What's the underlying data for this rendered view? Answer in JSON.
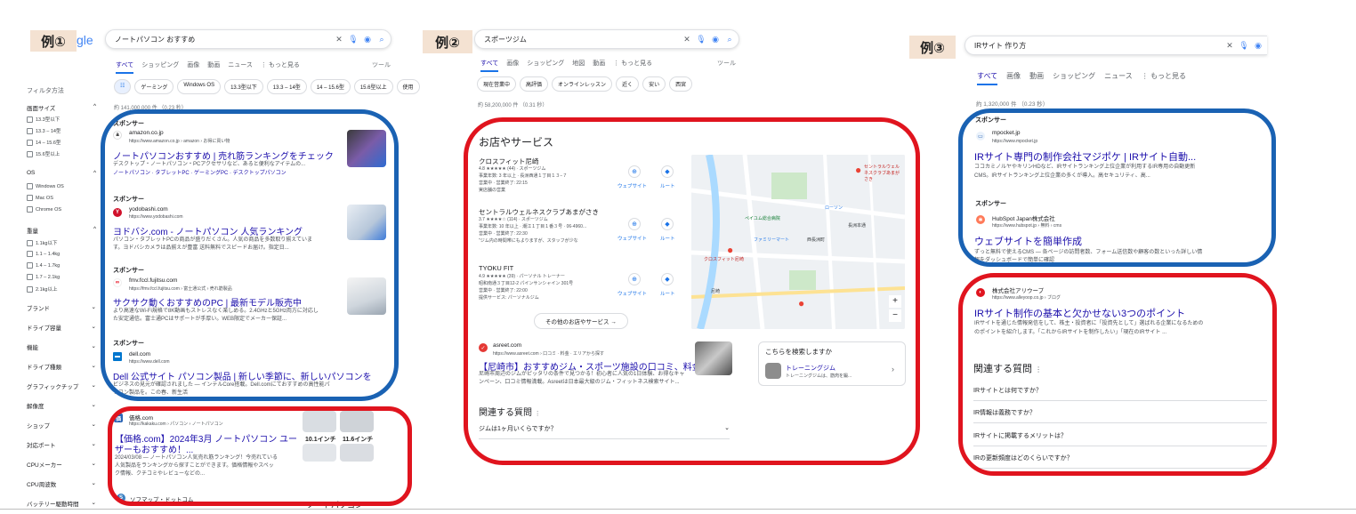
{
  "panel1": {
    "tag": "例①",
    "logo_tail": "gle",
    "query": "ノートパソコン おすすめ",
    "tabs": [
      "すべて",
      "ショッピング",
      "画像",
      "動画",
      "ニュース",
      "⋮ もっと見る"
    ],
    "tools": "ツール",
    "chips": [
      "ゲーミング",
      "Windows OS",
      "13.3型以下",
      "13.3 – 14型",
      "14 – 15.6型",
      "15.6型以上",
      "使用"
    ],
    "result_count": "約 141,000,000 件 （0.23 秒）",
    "filters_title": "フィルタ方法",
    "filter_screen": "画面サイズ",
    "screen_opts": [
      "13.3型以下",
      "13.3 – 14型",
      "14 – 15.6型",
      "15.6型以上"
    ],
    "filter_os": "OS",
    "os_opts": [
      "Windows OS",
      "Mac OS",
      "Chrome OS"
    ],
    "filter_weight": "重量",
    "weight_opts": [
      "1.1kg以下",
      "1.1 – 1.4kg",
      "1.4 – 1.7kg",
      "1.7 – 2.1kg",
      "2.1kg以上"
    ],
    "more_filters": [
      "ブランド",
      "ドライブ容量",
      "機能",
      "ドライブ種類",
      "グラフィックチップ",
      "解像度",
      "ショップ",
      "対応ポート",
      "CPUメーカー",
      "CPU周波数",
      "バッテリー駆動時間"
    ],
    "ads": [
      {
        "sponsor": "スポンサー",
        "site": "amazon.co.jp",
        "url": "https://www.amazon.co.jp › amazon › お得に買い物",
        "title": "ノートパソコンおすすめ | 売れ筋ランキングをチェック",
        "desc1": "デスクトップ・ノートパソコン・PCアクセサリなど、あると便利なアイテムの...",
        "desc2": "ノートパソコン · タブレットPC · ゲーミングPC · デスクトップパソコン"
      },
      {
        "sponsor": "スポンサー",
        "site": "yodobashi.com",
        "url": "https://www.yodobashi.com",
        "title": "ヨドバシ.com - ノートパソコン 人気ランキング",
        "desc1": "パソコン・タブレットPCの商品が盛りだくさん。人気の商品を多数取り揃えていま",
        "desc2": "す。ヨドバシカメラは品揃えが豊富 送料無料でスピードお届け。指定日..."
      },
      {
        "sponsor": "スポンサー",
        "site": "fmv.fccl.fujitsu.com",
        "url": "https://fmv.fccl.fujitsu.com › 富士通公式 › 売れ筋製品",
        "title": "サクサク動くおすすめのPC | 最新モデル販売中",
        "desc1": "より高速なWi-Fi規格で8K動画もストレスなく楽しめる。2.4GHzと5GHz両方に対応し",
        "desc2": "た安定通信。富士通PCはサポートが手厚い。WEB限定でメーカー保証..."
      },
      {
        "sponsor": "スポンサー",
        "site": "dell.com",
        "url": "https://www.dell.com",
        "title": "Dell 公式サイト パソコン製品 | 新しい季節に、新しいパソコンを",
        "desc1": "ビジネスの見元が確認されました — インテルCore搭載。Dell.comにておすすめの高性能パ",
        "desc2": "ソコン製品を。この春、新生活"
      }
    ],
    "organic": {
      "site": "価格.com",
      "url": "https://kakaku.com › パソコン › ノートパソコン",
      "title1": "【価格.com】2024年3月 ノートパソコン ユー",
      "title2": "ザーもおすすめ！...",
      "desc1": "2024/03/08 — ノートパソコン人気売れ筋ランキング！今売れている",
      "desc2": "人気製品をランキングから探すことができます。価格情報やスペッ",
      "desc3": "ク情報、クチコミやレビューなどの...",
      "thumb_labels": [
        "10.1インチ",
        "11.6インチ"
      ]
    },
    "next_site": "ソフマップ・ドットコム",
    "next_thumb": "ノートパソコン"
  },
  "panel2": {
    "tag": "例②",
    "query": "スポーツジム",
    "tabs": [
      "すべて",
      "画像",
      "ショッピング",
      "地図",
      "動画",
      "⋮ もっと見る"
    ],
    "tools": "ツール",
    "chips": [
      "現在営業中",
      "高評価",
      "オンラインレッスン",
      "近く",
      "安い",
      "西宮"
    ],
    "result_count": "約 58,200,000 件 （0.31 秒）",
    "local_title": "お店やサービス",
    "places": [
      {
        "name": "クロスフィット尼崎",
        "rating": "4.8 ★★★★★ (44) · スポーツジム",
        "l1": "事業年数: 3 年以上 · 長洲西通１丁目１３−７",
        "l2": "営業中 · 営業終了: 22:15",
        "l3": "実店舗の営業"
      },
      {
        "name": "セントラルウェルネスクラブあまがさき",
        "rating": "3.7 ★★★★☆ (114) · スポーツジム",
        "l1": "事業年数: 10 年以上 · 潮江１丁目１番３号 · 06-4960...",
        "l2": "営業中 · 営業終了: 22:30",
        "l3": "\"ジム内の時間帯にもよりますが、スタッフが少な"
      },
      {
        "name": "TYOKU FIT",
        "rating": "4.9 ★★★★★ (39) · パーソナル トレーナー",
        "l1": "昭和南通３丁目12-2 パインサンシャイン 301号",
        "l2": "営業中 · 営業終了: 22:00",
        "l3": "提供サービス: パーソナルジム"
      }
    ],
    "btn_web": "ウェブサイト",
    "btn_route": "ルート",
    "more_places": "その他のお店やサービス →",
    "map_labels": [
      "セントラルウェルネスクラブあまがさき",
      "ペイユム総合病院",
      "ファミリーマート",
      "クロスフィット尼崎",
      "長洲本通",
      "西長洲町",
      "ローソン",
      "尼崎"
    ],
    "ad": {
      "site": "asreet.com",
      "url": "https://www.asreet.com › 口コミ · 料金 · エリアから探す",
      "title": "【尼崎市】おすすめジム・スポーツ施設の口コミ、料金",
      "desc1": "尼崎市周辺のジムがピッタリの条件で見つかる！初心者に人気の1日体験、お得なキャ",
      "desc2": "ンペーン、口コミ情報満載。Asreetは日本最大級のジム・フィットネス検索サイト..."
    },
    "side_title": "こちらを検索しますか",
    "side_item": "トレーニングジム",
    "side_sub": "トレーニングジムは、筋肉を鍛...",
    "paa_title": "関連する質問",
    "paa": [
      "ジムは1ヶ月いくらですか？"
    ]
  },
  "panel3": {
    "tag": "例③",
    "query": "IRサイト 作り方",
    "tabs": [
      "すべて",
      "画像",
      "動画",
      "ショッピング",
      "ニュース",
      "⋮ もっと見る"
    ],
    "result_count": "約 1,320,000 件 （0.23 秒）",
    "ads": [
      {
        "sponsor": "スポンサー",
        "site": "mpocket.jp",
        "url": "https://www.mpocket.jp",
        "title": "IRサイト専門の制作会社マジポケ | IRサイト自動...",
        "desc1": "ココカミノルヤやキリンHDなど、IRサイトランキング上位企業が利用するIR専用の自動更新",
        "desc2": "CMS。IRサイトランキング上位企業の多くが導入。高セキュリティ、高..."
      },
      {
        "sponsor": "スポンサー",
        "site": "HubSpot Japan株式会社",
        "url": "https://www.hubspot.jp › 無料 › cms",
        "title": "ウェブサイトを簡単作成",
        "desc1": "ずっと無料で使えるCMS — 各ページの訪問者数、フォーム送信数や顧客の数といった詳しい情",
        "desc2": "報をダッシュボードで簡単に確認"
      }
    ],
    "organic": {
      "site": "株式会社アリウープ",
      "url": "https://www.alleyoop.co.jp › ブログ",
      "title": "IRサイト制作の基本と欠かせない3つのポイント",
      "desc1": "IRサイトを通じた情報発信をして、株主・投資者に「投資先として」選ばれる企業になるための",
      "desc2": "のポイントを紹介します。「これからIRサイトを制作したい」「現在のIRサイト ..."
    },
    "paa_title": "関連する質問",
    "paa": [
      "IRサイトとは何ですか？",
      "IR情報は義務ですか？",
      "IRサイトに掲載するメリットは？",
      "IRの更新頻度はどのくらいですか？"
    ]
  },
  "colors": {
    "blue_ring": "#1a62b3",
    "red_ring": "#e0141e",
    "tag_bg": "#f4e2d2",
    "link": "#1a0dab"
  }
}
